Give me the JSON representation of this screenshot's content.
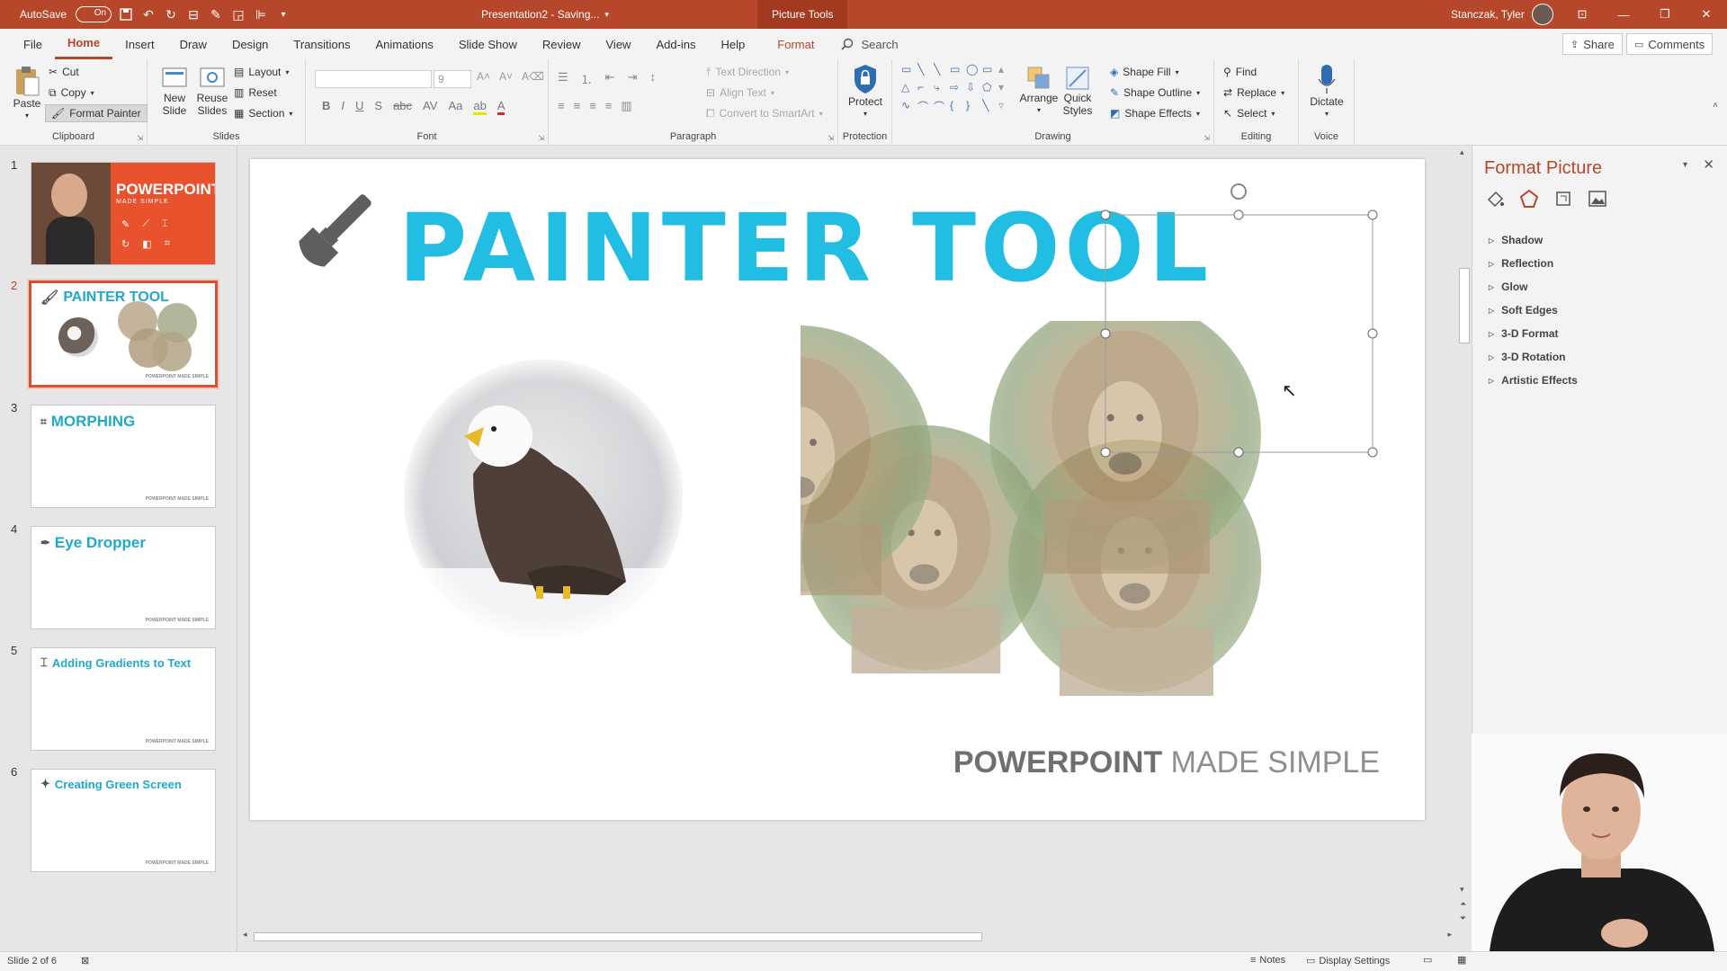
{
  "titlebar": {
    "autosave_label": "AutoSave",
    "autosave_state": "On",
    "doc_title": "Presentation2 - Saving...",
    "context_tab": "Picture Tools",
    "user_name": "Stanczak, Tyler",
    "accent": "#b7472a"
  },
  "menu": {
    "tabs": [
      "File",
      "Home",
      "Insert",
      "Draw",
      "Design",
      "Transitions",
      "Animations",
      "Slide Show",
      "Review",
      "View",
      "Add-ins",
      "Help",
      "Format"
    ],
    "active_tab": "Home",
    "search_label": "Search",
    "share_label": "Share",
    "comments_label": "Comments"
  },
  "ribbon": {
    "clipboard": {
      "paste": "Paste",
      "cut": "Cut",
      "copy": "Copy",
      "format_painter": "Format Painter",
      "label": "Clipboard"
    },
    "slides": {
      "new_slide": "New Slide",
      "reuse_slides": "Reuse Slides",
      "layout": "Layout",
      "reset": "Reset",
      "section": "Section",
      "label": "Slides"
    },
    "font": {
      "size": "9",
      "label": "Font"
    },
    "paragraph": {
      "text_direction": "Text Direction",
      "align_text": "Align Text",
      "convert_smartart": "Convert to SmartArt",
      "label": "Paragraph"
    },
    "protection": {
      "protect": "Protect",
      "label": "Protection"
    },
    "drawing": {
      "arrange": "Arrange",
      "quick_styles": "Quick Styles",
      "shape_fill": "Shape Fill",
      "shape_outline": "Shape Outline",
      "shape_effects": "Shape Effects",
      "label": "Drawing"
    },
    "editing": {
      "find": "Find",
      "replace": "Replace",
      "select": "Select",
      "label": "Editing"
    },
    "voice": {
      "dictate": "Dictate",
      "label": "Voice"
    }
  },
  "slides": [
    {
      "num": "1",
      "title": "POWERPOINT",
      "subtitle": "MADE SIMPLE"
    },
    {
      "num": "2",
      "title": "PAINTER TOOL"
    },
    {
      "num": "3",
      "title": "MORPHING"
    },
    {
      "num": "4",
      "title": "Eye Dropper"
    },
    {
      "num": "5",
      "title": "Adding Gradients to Text"
    },
    {
      "num": "6",
      "title": "Creating Green Screen"
    }
  ],
  "slide_footer_small": "POWERPOINT MADE SIMPLE",
  "current_slide": {
    "title": "PAINTER TOOL",
    "footer_bold": "POWERPOINT",
    "footer_light": "MADE SIMPLE",
    "title_color": "#22bde3"
  },
  "format_pane": {
    "title": "Format Picture",
    "items": [
      "Shadow",
      "Reflection",
      "Glow",
      "Soft Edges",
      "3-D Format",
      "3-D Rotation",
      "Artistic Effects"
    ]
  },
  "status": {
    "slide_info": "Slide 2 of 6",
    "notes": "Notes",
    "display_settings": "Display Settings"
  }
}
